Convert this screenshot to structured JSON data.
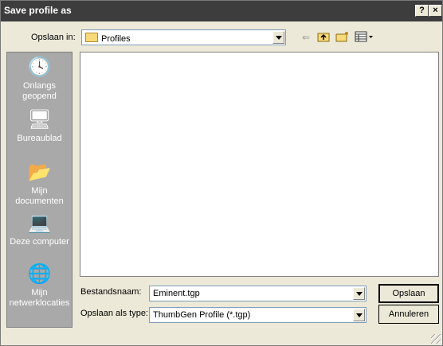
{
  "window": {
    "title": "Save profile as",
    "help_label": "?",
    "close_label": "×"
  },
  "lookin": {
    "label": "Opslaan in:",
    "value": "Profiles",
    "icon": "folder-icon"
  },
  "toolbar": {
    "back_icon": "back-arrow-icon",
    "up_icon": "up-folder-icon",
    "newfolder_icon": "new-folder-icon",
    "view_icon": "view-menu-icon"
  },
  "places": [
    {
      "label": "Onlangs geopend",
      "icon": "recent-icon"
    },
    {
      "label": "Bureaublad",
      "icon": "desktop-icon"
    },
    {
      "label": "Mijn documenten",
      "icon": "documents-icon"
    },
    {
      "label": "Deze computer",
      "icon": "computer-icon"
    },
    {
      "label": "Mijn netwerklocaties",
      "icon": "network-icon"
    }
  ],
  "filename": {
    "label": "Bestandsnaam:",
    "value": "Eminent.tgp"
  },
  "filetype": {
    "label": "Opslaan als type:",
    "value": "ThumbGen Profile (*.tgp)"
  },
  "buttons": {
    "save": "Opslaan",
    "cancel": "Annuleren"
  }
}
